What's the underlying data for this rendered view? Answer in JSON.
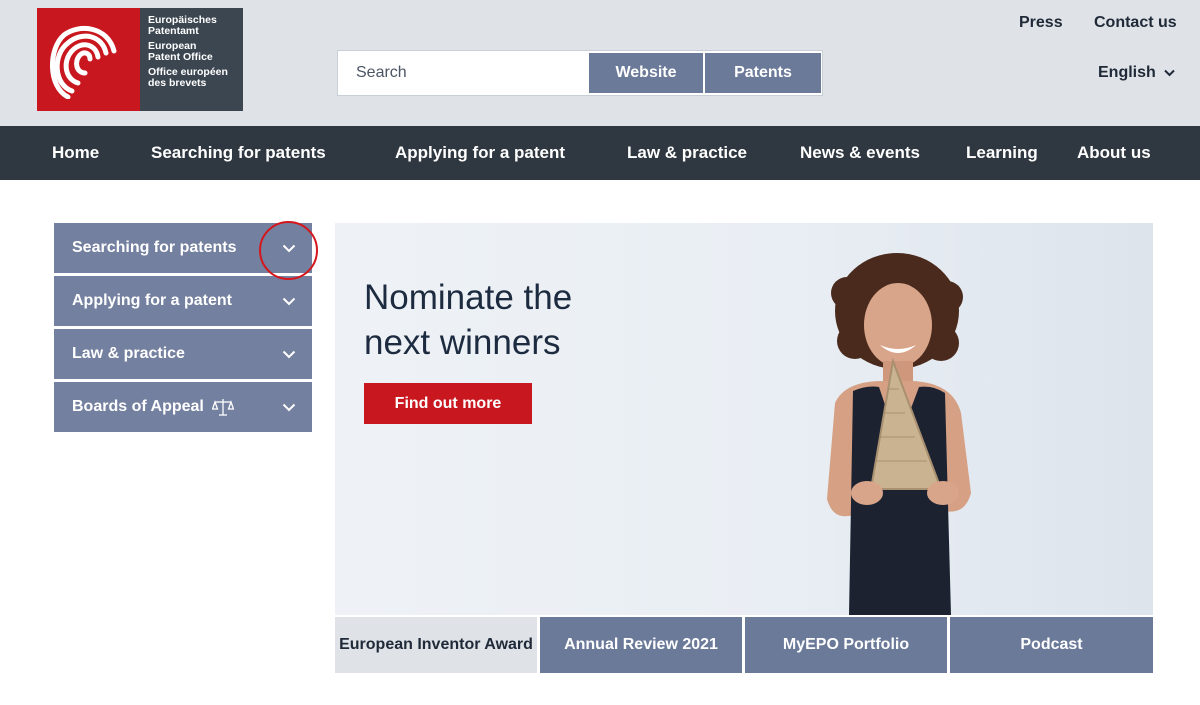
{
  "header": {
    "logo": {
      "line1": "Europäisches\nPatentamt",
      "line2": "European\nPatent Office",
      "line3": "Office européen\ndes brevets"
    },
    "search": {
      "placeholder": "Search",
      "scope_website": "Website",
      "scope_patents": "Patents"
    },
    "links": {
      "press": "Press",
      "contact": "Contact us"
    },
    "language": "English"
  },
  "nav": {
    "items": [
      "Home",
      "Searching for patents",
      "Applying for a patent",
      "Law & practice",
      "News & events",
      "Learning",
      "About us"
    ]
  },
  "sidebar": {
    "items": [
      "Searching for patents",
      "Applying for a patent",
      "Law & practice",
      "Boards of Appeal"
    ]
  },
  "hero": {
    "title_line1": "Nominate the",
    "title_line2": "next winners",
    "button": "Find out more"
  },
  "tabs": [
    "European Inventor Award",
    "Annual Review 2021",
    "MyEPO Portfolio",
    "Podcast"
  ],
  "colors": {
    "brand_red": "#c8171e",
    "nav_dark": "#2f3740",
    "menu_blue": "#74809f",
    "highlight": "#d4171d"
  }
}
